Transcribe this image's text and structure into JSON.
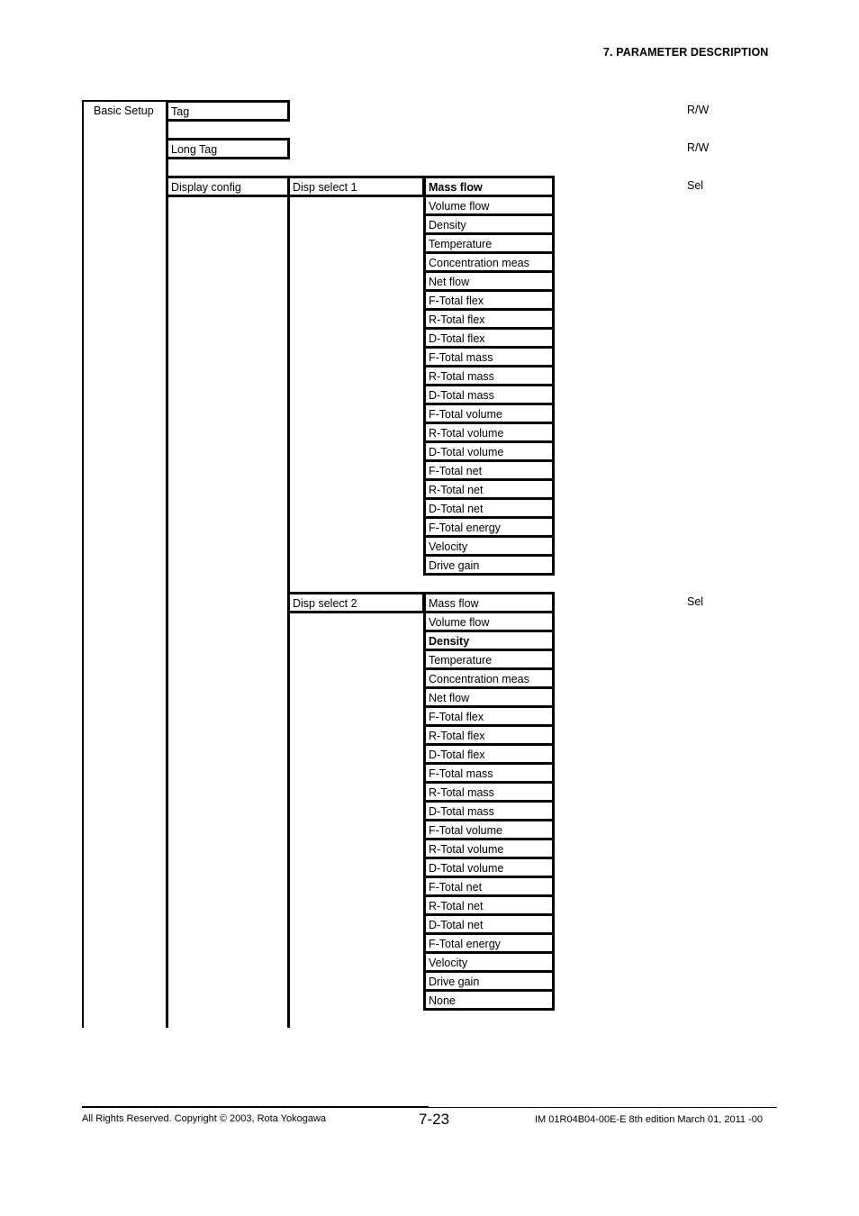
{
  "header": {
    "section_title": "7.  PARAMETER DESCRIPTION"
  },
  "tree": {
    "root": {
      "label": "Basic Setup"
    },
    "level1": [
      {
        "label": "Tag",
        "access": "R/W"
      },
      {
        "label": "Long Tag",
        "access": "R/W"
      },
      {
        "label": "Display config"
      }
    ],
    "display_config": {
      "disp_select_1": {
        "label": "Disp select 1",
        "access": "Sel",
        "default_index": 0,
        "options": [
          "Mass flow",
          "Volume flow",
          "Density",
          "Temperature",
          "Concentration meas",
          "Net flow",
          "F-Total flex",
          "R-Total flex",
          "D-Total flex",
          "F-Total mass",
          "R-Total mass",
          "D-Total mass",
          "F-Total volume",
          "R-Total volume",
          "D-Total volume",
          "F-Total net",
          "R-Total net",
          "D-Total net",
          "F-Total energy",
          "Velocity",
          "Drive gain"
        ]
      },
      "disp_select_2": {
        "label": "Disp select 2",
        "access": "Sel",
        "default_index": 2,
        "options": [
          "Mass flow",
          "Volume flow",
          "Density",
          "Temperature",
          "Concentration meas",
          "Net flow",
          "F-Total flex",
          "R-Total flex",
          "D-Total flex",
          "F-Total mass",
          "R-Total mass",
          "D-Total mass",
          "F-Total volume",
          "R-Total volume",
          "D-Total volume",
          "F-Total net",
          "R-Total net",
          "D-Total net",
          "F-Total energy",
          "Velocity",
          "Drive gain",
          "None"
        ]
      }
    }
  },
  "footer": {
    "copyright": "All Rights Reserved. Copyright © 2003, Rota Yokogawa",
    "page_number": "7-23",
    "document_id": "IM 01R04B04-00E-E  8th edition March 01, 2011 -00"
  }
}
